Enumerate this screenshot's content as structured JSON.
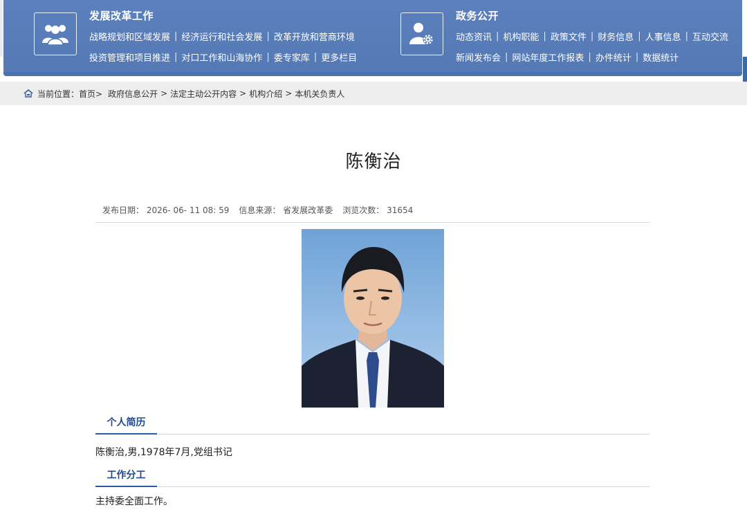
{
  "header": {
    "left": {
      "title": "发展改革工作",
      "icon": "people-group-icon",
      "row1": [
        "战略规划和区域发展",
        "经济运行和社会发展",
        "改革开放和营商环境"
      ],
      "row2": [
        "投资管理和项目推进",
        "对口工作和山海协作",
        "委专家库",
        "更多栏目"
      ]
    },
    "right": {
      "title": "政务公开",
      "icon": "user-gear-icon",
      "row1": [
        "动态资讯",
        "机构职能",
        "政策文件",
        "财务信息",
        "人事信息",
        "互动交流"
      ],
      "row2": [
        "新闻发布会",
        "网站年度工作报表",
        "办件统计",
        "数据统计"
      ]
    }
  },
  "breadcrumb": {
    "prefix": "当前位置：",
    "items": [
      "首页>",
      "政府信息公开",
      ">",
      "法定主动公开内容",
      ">",
      "机构介绍",
      ">",
      "本机关负责人"
    ]
  },
  "article": {
    "title": "陈衡治",
    "date_label": "发布日期：",
    "date_value": "2026- 06- 11 08: 59",
    "source_label": "信息来源：",
    "source_value": "省发展改革委",
    "views_label": "浏览次数：",
    "views_value": "31654",
    "bio_heading": "个人简历",
    "bio_text": "陈衡治,男,1978年7月,党组书记",
    "duty_heading": "工作分工",
    "duty_text": "主持委全面工作。"
  },
  "colors": {
    "header_blue": "#5479b5",
    "accent_blue": "#2b5aa5",
    "breadcrumb_bg": "#ededed"
  }
}
